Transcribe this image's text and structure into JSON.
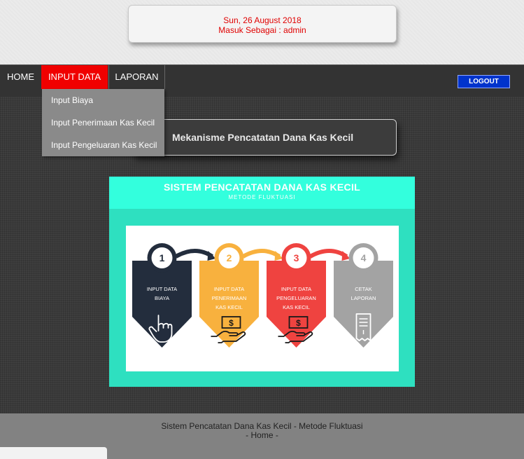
{
  "header": {
    "date": "Sun, 26 August 2018",
    "login_as": "Masuk Sebagai : admin"
  },
  "nav": {
    "home": "HOME",
    "input_data": "INPUT DATA",
    "laporan": "LAPORAN",
    "logout": "LOGOUT"
  },
  "dropdown": {
    "items": [
      {
        "label": "Input Biaya"
      },
      {
        "label": "Input Penerimaan Kas Kecil"
      },
      {
        "label": "Input Pengeluaran Kas Kecil"
      }
    ]
  },
  "main": {
    "title": "Mekanisme Pencatatan Dana Kas Kecil"
  },
  "infographic": {
    "title": "SISTEM PENCATATAN DANA KAS KECIL",
    "subtitle": "METODE FLUKTUASI",
    "steps": [
      {
        "num": "1",
        "line1": "INPUT DATA",
        "line2": "BIAYA",
        "line3": "",
        "color": "#232d3d",
        "icon": "hand-pointer-icon"
      },
      {
        "num": "2",
        "line1": "INPUT DATA",
        "line2": "PENERIMAAN",
        "line3": "KAS KECIL",
        "color": "#f8b13e",
        "icon": "hand-money-icon"
      },
      {
        "num": "3",
        "line1": "INPUT DATA",
        "line2": "PENGELUARAN",
        "line3": "KAS KECIL",
        "color": "#ef4340",
        "icon": "hand-money-icon"
      },
      {
        "num": "4",
        "line1": "CETAK",
        "line2": "LAPORAN",
        "line3": "",
        "color": "#a3a3a3",
        "icon": "receipt-icon"
      }
    ]
  },
  "footer": {
    "line1": "Sistem Pencatatan Dana Kas Kecil - Metode Fluktuasi",
    "line2": "- Home -"
  }
}
